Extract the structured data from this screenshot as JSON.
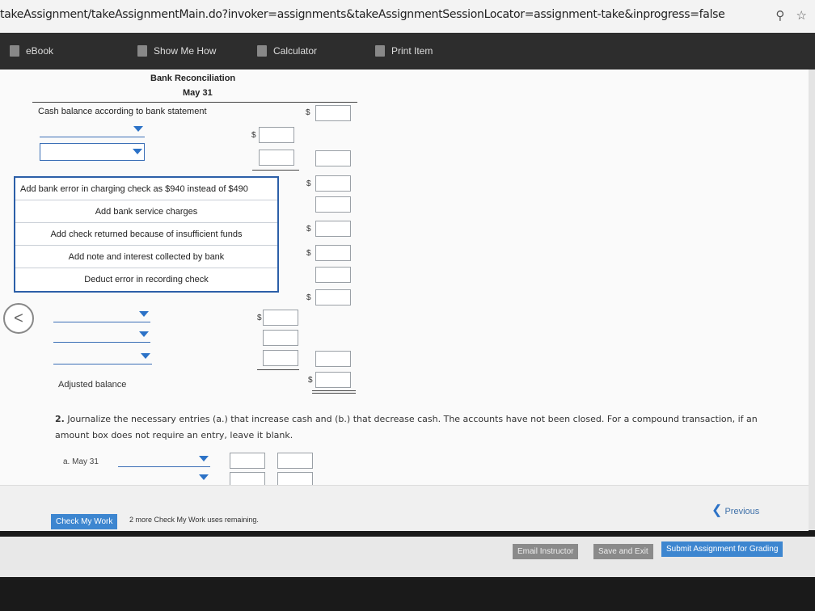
{
  "browser": {
    "url": "takeAssignment/takeAssignmentMain.do?invoker=assignments&takeAssignmentSessionLocator=assignment-take&inprogress=false",
    "zoom_icon": "magnifier-icon",
    "bookmark_icon": "star-icon"
  },
  "toolbar": {
    "ebook": "eBook",
    "show_me_how": "Show Me How",
    "calculator": "Calculator",
    "print_item": "Print Item"
  },
  "reconciliation": {
    "title": "Bank Reconciliation",
    "date": "May 31",
    "cash_balance_label": "Cash balance according to bank statement",
    "adjusted_balance_label": "Adjusted balance",
    "currency_symbol": "$"
  },
  "dropdown_options": [
    "Add bank error in charging check as $940 instead of $490",
    "Add bank service charges",
    "Add check returned because of insufficient funds",
    "Add note and interest collected by bank",
    "Deduct error in recording check"
  ],
  "question2": {
    "number": "2.",
    "text": "Journalize the necessary entries (a.) that increase cash and (b.) that decrease cash. The accounts have not been closed. For a compound transaction, if an amount box does not require an entry, leave it blank.",
    "entry_a_label": "a. May 31"
  },
  "footer": {
    "check_my_work": "Check My Work",
    "remaining_text": "2 more Check My Work uses remaining.",
    "previous": "Previous",
    "email_instructor": "Email Instructor",
    "save_and_exit": "Save and Exit",
    "submit": "Submit Assignment for Grading"
  },
  "colors": {
    "accent": "#2c72c7",
    "toolbar_bg": "#2d2d2d",
    "submit_bg": "#3d86d0"
  }
}
